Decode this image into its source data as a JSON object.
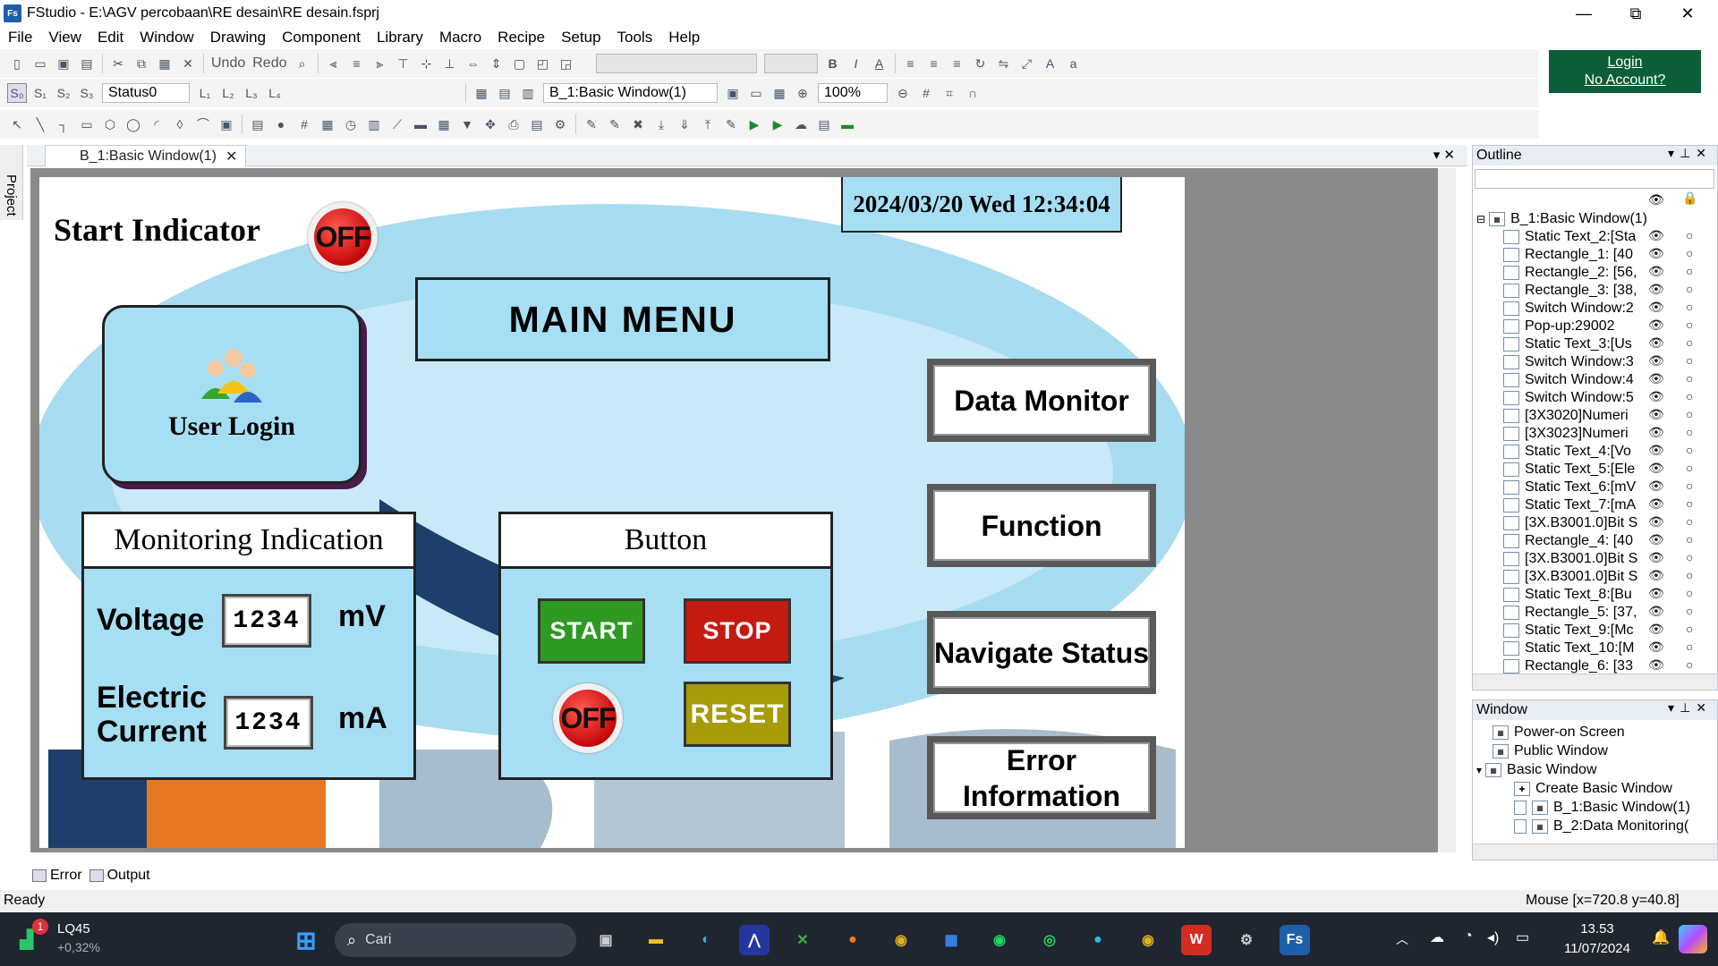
{
  "window": {
    "title": "FStudio - E:\\AGV percobaan\\RE desain\\RE desain.fsprj",
    "minimize": "—",
    "maximize": "⧉",
    "close": "✕"
  },
  "menu": [
    "File",
    "View",
    "Edit",
    "Window",
    "Drawing",
    "Component",
    "Library",
    "Macro",
    "Recipe",
    "Setup",
    "Tools",
    "Help"
  ],
  "toolbar": {
    "undo": "Undo",
    "redo": "Redo",
    "status_combo": "Status0",
    "window_combo": "B_1:Basic Window(1)",
    "zoom": "100%"
  },
  "login": {
    "login": "Login",
    "no_account": "No Account?"
  },
  "side_tab": "Project",
  "doc_tab": "B_1:Basic Window(1)",
  "screen": {
    "datetime": "2024/03/20 Wed 12:34:04",
    "start_indicator": "Start Indicator",
    "off": "OFF",
    "user_login": "User Login",
    "main_menu": "MAIN MENU",
    "nav": {
      "data_monitor": "Data Monitor",
      "function": "Function",
      "navigate_status": "Navigate Status",
      "error_information": "Error Information"
    },
    "monitoring": {
      "title": "Monitoring Indication",
      "voltage": "Voltage",
      "voltage_value": "1234",
      "voltage_unit": "mV",
      "current": "Electric Current",
      "current_value": "1234",
      "current_unit": "mA"
    },
    "button": {
      "title": "Button",
      "start": "START",
      "stop": "STOP",
      "reset": "RESET"
    }
  },
  "outline": {
    "title": "Outline",
    "root": "B_1:Basic Window(1)",
    "items": [
      "Static Text_2:[Sta",
      "Rectangle_1: [40",
      "Rectangle_2: [56,",
      "Rectangle_3: [38,",
      "Switch Window:2",
      "Pop-up:29002",
      "Static Text_3:[Us",
      "Switch Window:3",
      "Switch Window:4",
      "Switch Window:5",
      "[3X3020]Numeri",
      "[3X3023]Numeri",
      "Static Text_4:[Vo",
      "Static Text_5:[Ele",
      "Static Text_6:[mV",
      "Static Text_7:[mA",
      "[3X.B3001.0]Bit S",
      "Rectangle_4: [40",
      "[3X.B3001.0]Bit S",
      "[3X.B3001.0]Bit S",
      "Static Text_8:[Bu",
      "Rectangle_5: [37,",
      "Static Text_9:[Mc",
      "Static Text_10:[M",
      "Rectangle_6: [33"
    ]
  },
  "window_panel": {
    "title": "Window",
    "items": [
      "Power-on Screen",
      "Public Window",
      "Basic Window",
      "Create Basic Window",
      "B_1:Basic Window(1)",
      "B_2:Data Monitoring("
    ]
  },
  "bottom_tabs": {
    "error": "Error",
    "output": "Output"
  },
  "status": {
    "ready": "Ready",
    "mouse": "Mouse [x=720.8 y=40.8]"
  },
  "taskbar": {
    "stock": "LQ45",
    "stock_change": "+0,32%",
    "stock_badge": "1",
    "search": "Cari",
    "time": "13.53",
    "date": "11/07/2024"
  },
  "colors": {
    "panel_blue": "#a6dff3",
    "start_green": "#2e9a23",
    "stop_red": "#c41a12",
    "reset_olive": "#a79b08",
    "login_green": "#0b5e39"
  }
}
